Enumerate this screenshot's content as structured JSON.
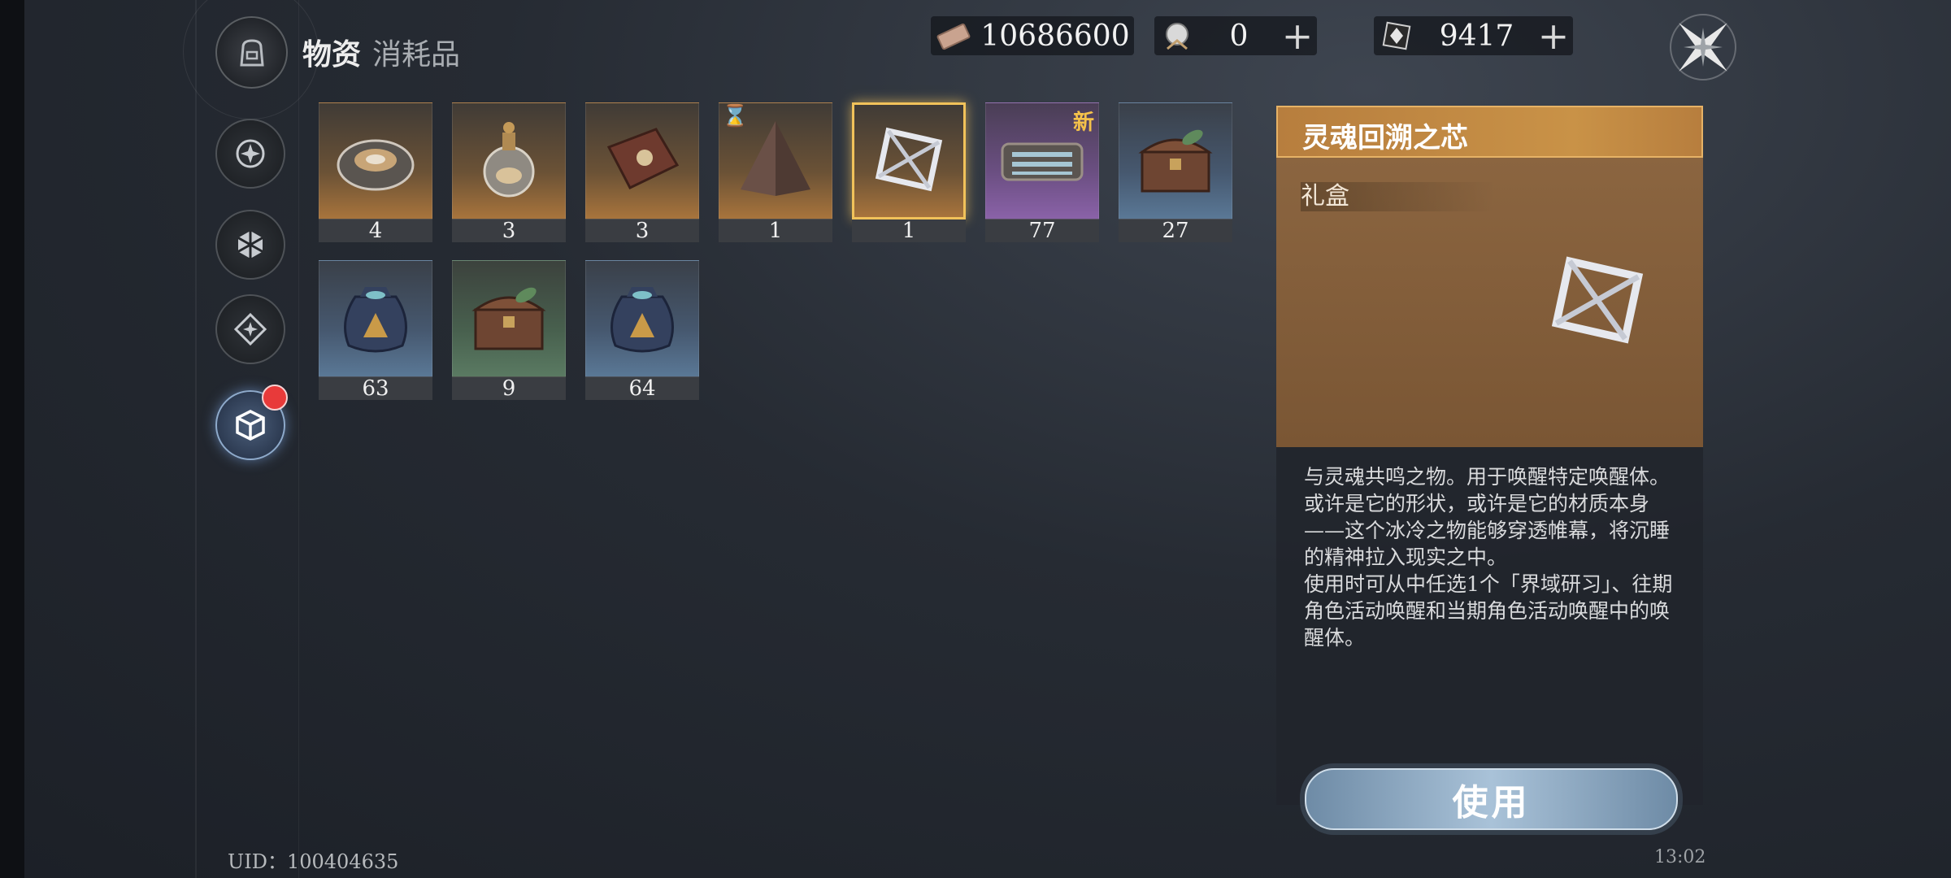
{
  "header": {
    "title": "物资",
    "subtitle": "消耗品"
  },
  "currencies": [
    {
      "icon": "ticket-icon",
      "value": "10686600"
    },
    {
      "icon": "orb-icon",
      "value": "0",
      "plus": "+"
    },
    {
      "icon": "crystal-icon",
      "value": "9417",
      "plus": "+"
    }
  ],
  "nav": [
    {
      "name": "nav-compass",
      "icon": "compass-emblem-icon"
    },
    {
      "name": "nav-hexagon",
      "icon": "hexagon-icon"
    },
    {
      "name": "nav-diamond",
      "icon": "diamond-icon"
    },
    {
      "name": "nav-cube",
      "icon": "cube-icon",
      "active": true
    }
  ],
  "items": [
    {
      "count": "4",
      "rarity": "orange",
      "icon": "dish-icon"
    },
    {
      "count": "3",
      "rarity": "orange",
      "icon": "potion-flask-icon"
    },
    {
      "count": "3",
      "rarity": "orange",
      "icon": "book-icon"
    },
    {
      "count": "1",
      "rarity": "orange",
      "icon": "pyramid-icon",
      "timed": "⌛"
    },
    {
      "count": "1",
      "rarity": "orange",
      "icon": "octahedron-frame-icon",
      "selected": true
    },
    {
      "count": "77",
      "rarity": "purple",
      "icon": "vial-case-icon",
      "badge": "新"
    },
    {
      "count": "27",
      "rarity": "blue",
      "icon": "treasure-chest-icon"
    },
    {
      "count": "63",
      "rarity": "blue",
      "icon": "pouch-icon"
    },
    {
      "count": "9",
      "rarity": "green",
      "icon": "treasure-chest-icon"
    },
    {
      "count": "64",
      "rarity": "blue",
      "icon": "pouch-icon"
    }
  ],
  "detail": {
    "title": "灵魂回溯之芯",
    "type": "礼盒",
    "description": "与灵魂共鸣之物。用于唤醒特定唤醒体。\n或许是它的形状，或许是它的材质本身——这个冰冷之物能够穿透帷幕，将沉睡的精神拉入现实之中。\n使用时可从中任选1个「界域研习」、往期角色活动唤醒和当期角色活动唤醒中的唤醒体。",
    "use_label": "使用"
  },
  "footer": {
    "uid": "UID：100404635",
    "time": "13:02"
  }
}
